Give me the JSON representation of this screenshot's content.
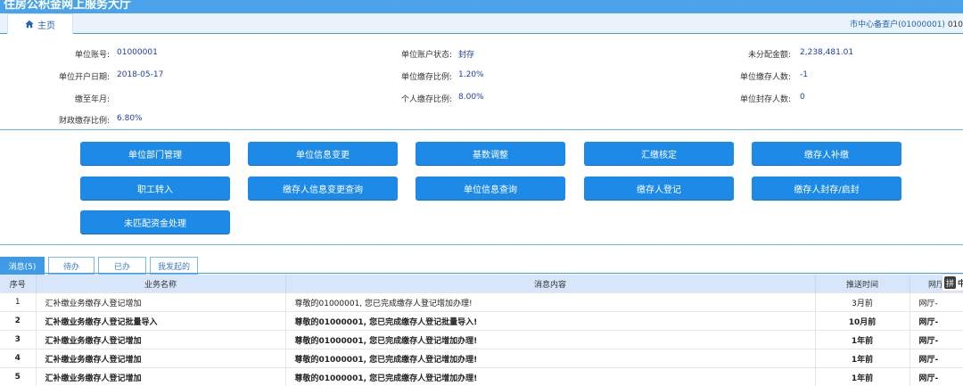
{
  "header": {
    "app_title": "住房公积金网上服务大厅",
    "home_tab": "主页",
    "account_label": "市中心备查户(01000001)",
    "account_extra": "010"
  },
  "info": {
    "unit_account_label": "单位账号:",
    "unit_account_value": "01000001",
    "unit_status_label": "单位账户状态:",
    "unit_status_value": "封存",
    "unallocated_label": "未分配金额:",
    "unallocated_value": "2,238,481.01",
    "open_date_label": "单位开户日期:",
    "open_date_value": "2018-05-17",
    "unit_ratio_label": "单位缴存比例:",
    "unit_ratio_value": "1.20%",
    "depositors_label": "单位缴存人数:",
    "depositors_value": "-1",
    "paid_month_label": "缴至年月:",
    "paid_month_value": "",
    "personal_ratio_label": "个人缴存比例:",
    "personal_ratio_value": "8.00%",
    "sealed_label": "单位封存人数:",
    "sealed_value": "0",
    "finance_ratio_label": "财政缴存比例:",
    "finance_ratio_value": "6.80%"
  },
  "actions": {
    "dept_mgmt": "单位部门管理",
    "unit_change": "单位信息变更",
    "base_adjust": "基数调整",
    "summary_check": "汇缴核定",
    "supplement": "缴存人补缴",
    "transfer_in": "职工转入",
    "depositor_change_query": "缴存人信息变更查询",
    "unit_query": "单位信息查询",
    "depositor_register": "缴存人登记",
    "seal_unseal": "缴存人封存/启封",
    "unmatched_funds": "未匹配资金处理"
  },
  "messages": {
    "tabs": [
      "消息(5)",
      "待办",
      "已办",
      "我发起的"
    ],
    "columns": [
      "序号",
      "业务名称",
      "消息内容",
      "推送时间",
      "网厅"
    ],
    "rows": [
      {
        "no": "1",
        "biz": "汇补缴业务缴存人登记增加",
        "content": "尊敬的01000001, 您已完成缴存人登记增加办理!",
        "time": "3月前",
        "src": "网厅-"
      },
      {
        "no": "2",
        "biz": "汇补缴业务缴存人登记批量导入",
        "content": "尊敬的01000001, 您已完成缴存人登记批量导入!",
        "time": "10月前",
        "src": "网厅-"
      },
      {
        "no": "3",
        "biz": "汇补缴业务缴存人登记增加",
        "content": "尊敬的01000001, 您已完成缴存人登记增加办理!",
        "time": "1年前",
        "src": "网厅-"
      },
      {
        "no": "4",
        "biz": "汇补缴业务缴存人登记增加",
        "content": "尊敬的01000001, 您已完成缴存人登记增加办理!",
        "time": "1年前",
        "src": "网厅-"
      },
      {
        "no": "5",
        "biz": "汇补缴业务缴存人登记增加",
        "content": "尊敬的01000001, 您已完成缴存人登记增加办理!",
        "time": "1年前",
        "src": "网厅-"
      }
    ]
  },
  "ime": {
    "pin": "拼",
    "zh": "中"
  }
}
